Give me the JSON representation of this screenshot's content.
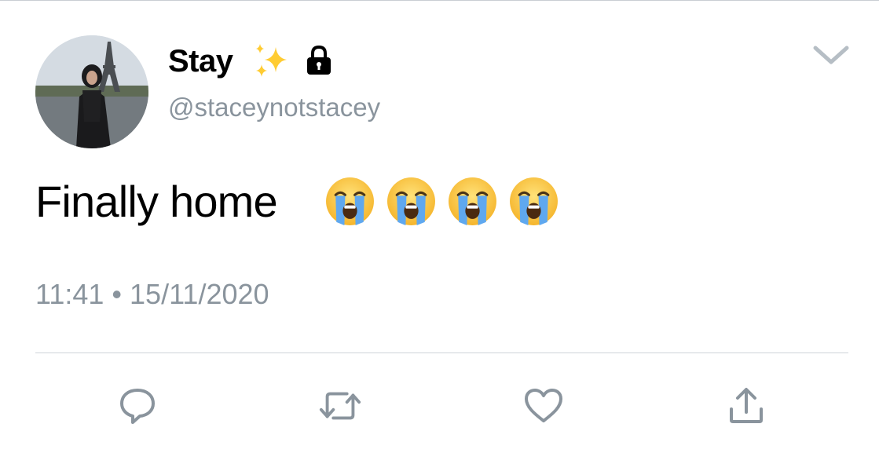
{
  "tweet": {
    "display_name": "Stay",
    "handle": "@staceynotstacey",
    "text": "Finally home",
    "emoji": [
      "loudly-crying-face",
      "loudly-crying-face",
      "loudly-crying-face",
      "loudly-crying-face"
    ],
    "timestamp": "11:41 • 15/11/2020",
    "name_icons": [
      "sparkles-icon",
      "lock-icon"
    ]
  },
  "actions": [
    {
      "name": "reply",
      "icon": "reply-icon"
    },
    {
      "name": "retweet",
      "icon": "retweet-icon"
    },
    {
      "name": "like",
      "icon": "heart-icon"
    },
    {
      "name": "share",
      "icon": "share-icon"
    }
  ],
  "colors": {
    "text": "#000000",
    "secondary_text": "#8a949d",
    "divider": "#cdd3d8",
    "lock": "#000000",
    "sparkles": "#ffcc33"
  }
}
